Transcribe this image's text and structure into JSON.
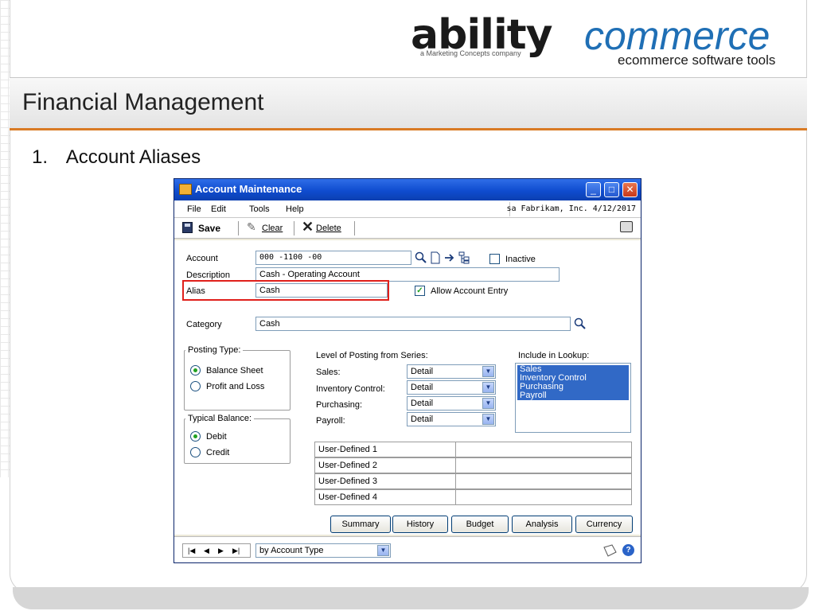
{
  "brand": {
    "name_part1": "ability",
    "name_part2": "commerce",
    "tagline": "a Marketing Concepts company",
    "subtitle": "ecommerce software tools"
  },
  "slide": {
    "title": "Financial Management",
    "bullet_number": "1.",
    "bullet_text": "Account Aliases"
  },
  "window": {
    "title": "Account Maintenance",
    "menu": [
      "File",
      "Edit",
      "Tools",
      "Help"
    ],
    "company_info": "sa  Fabrikam, Inc.  4/12/2017",
    "toolbar": {
      "save": "Save",
      "clear": "Clear",
      "delete": "Delete"
    },
    "fields": {
      "account_label": "Account",
      "account_value": "000 -1100 -00",
      "inactive_label": "Inactive",
      "description_label": "Description",
      "description_value": "Cash - Operating Account",
      "alias_label": "Alias",
      "alias_value": "Cash",
      "allow_entry_label": "Allow Account Entry",
      "category_label": "Category",
      "category_value": "Cash"
    },
    "posting_type": {
      "title": "Posting Type:",
      "options": [
        "Balance Sheet",
        "Profit and Loss"
      ],
      "selected": "Balance Sheet"
    },
    "typical_balance": {
      "title": "Typical Balance:",
      "options": [
        "Debit",
        "Credit"
      ],
      "selected": "Debit"
    },
    "level_of_posting": {
      "title": "Level of Posting from Series:",
      "rows": [
        {
          "label": "Sales:",
          "value": "Detail"
        },
        {
          "label": "Inventory Control:",
          "value": "Detail"
        },
        {
          "label": "Purchasing:",
          "value": "Detail"
        },
        {
          "label": "Payroll:",
          "value": "Detail"
        }
      ]
    },
    "include_lookup": {
      "title": "Include in Lookup:",
      "items": [
        "Sales",
        "Inventory Control",
        "Purchasing",
        "Payroll"
      ]
    },
    "user_defined": [
      "User-Defined 1",
      "User-Defined 2",
      "User-Defined 3",
      "User-Defined 4"
    ],
    "buttons": [
      "Summary",
      "History",
      "Budget",
      "Analysis",
      "Currency"
    ],
    "sort_by": "by Account Type"
  },
  "colors": {
    "accent_orange": "#d97b25",
    "brand_blue": "#1f6fb5",
    "highlight_red": "#e0201b",
    "selection_blue": "#3169c6"
  }
}
